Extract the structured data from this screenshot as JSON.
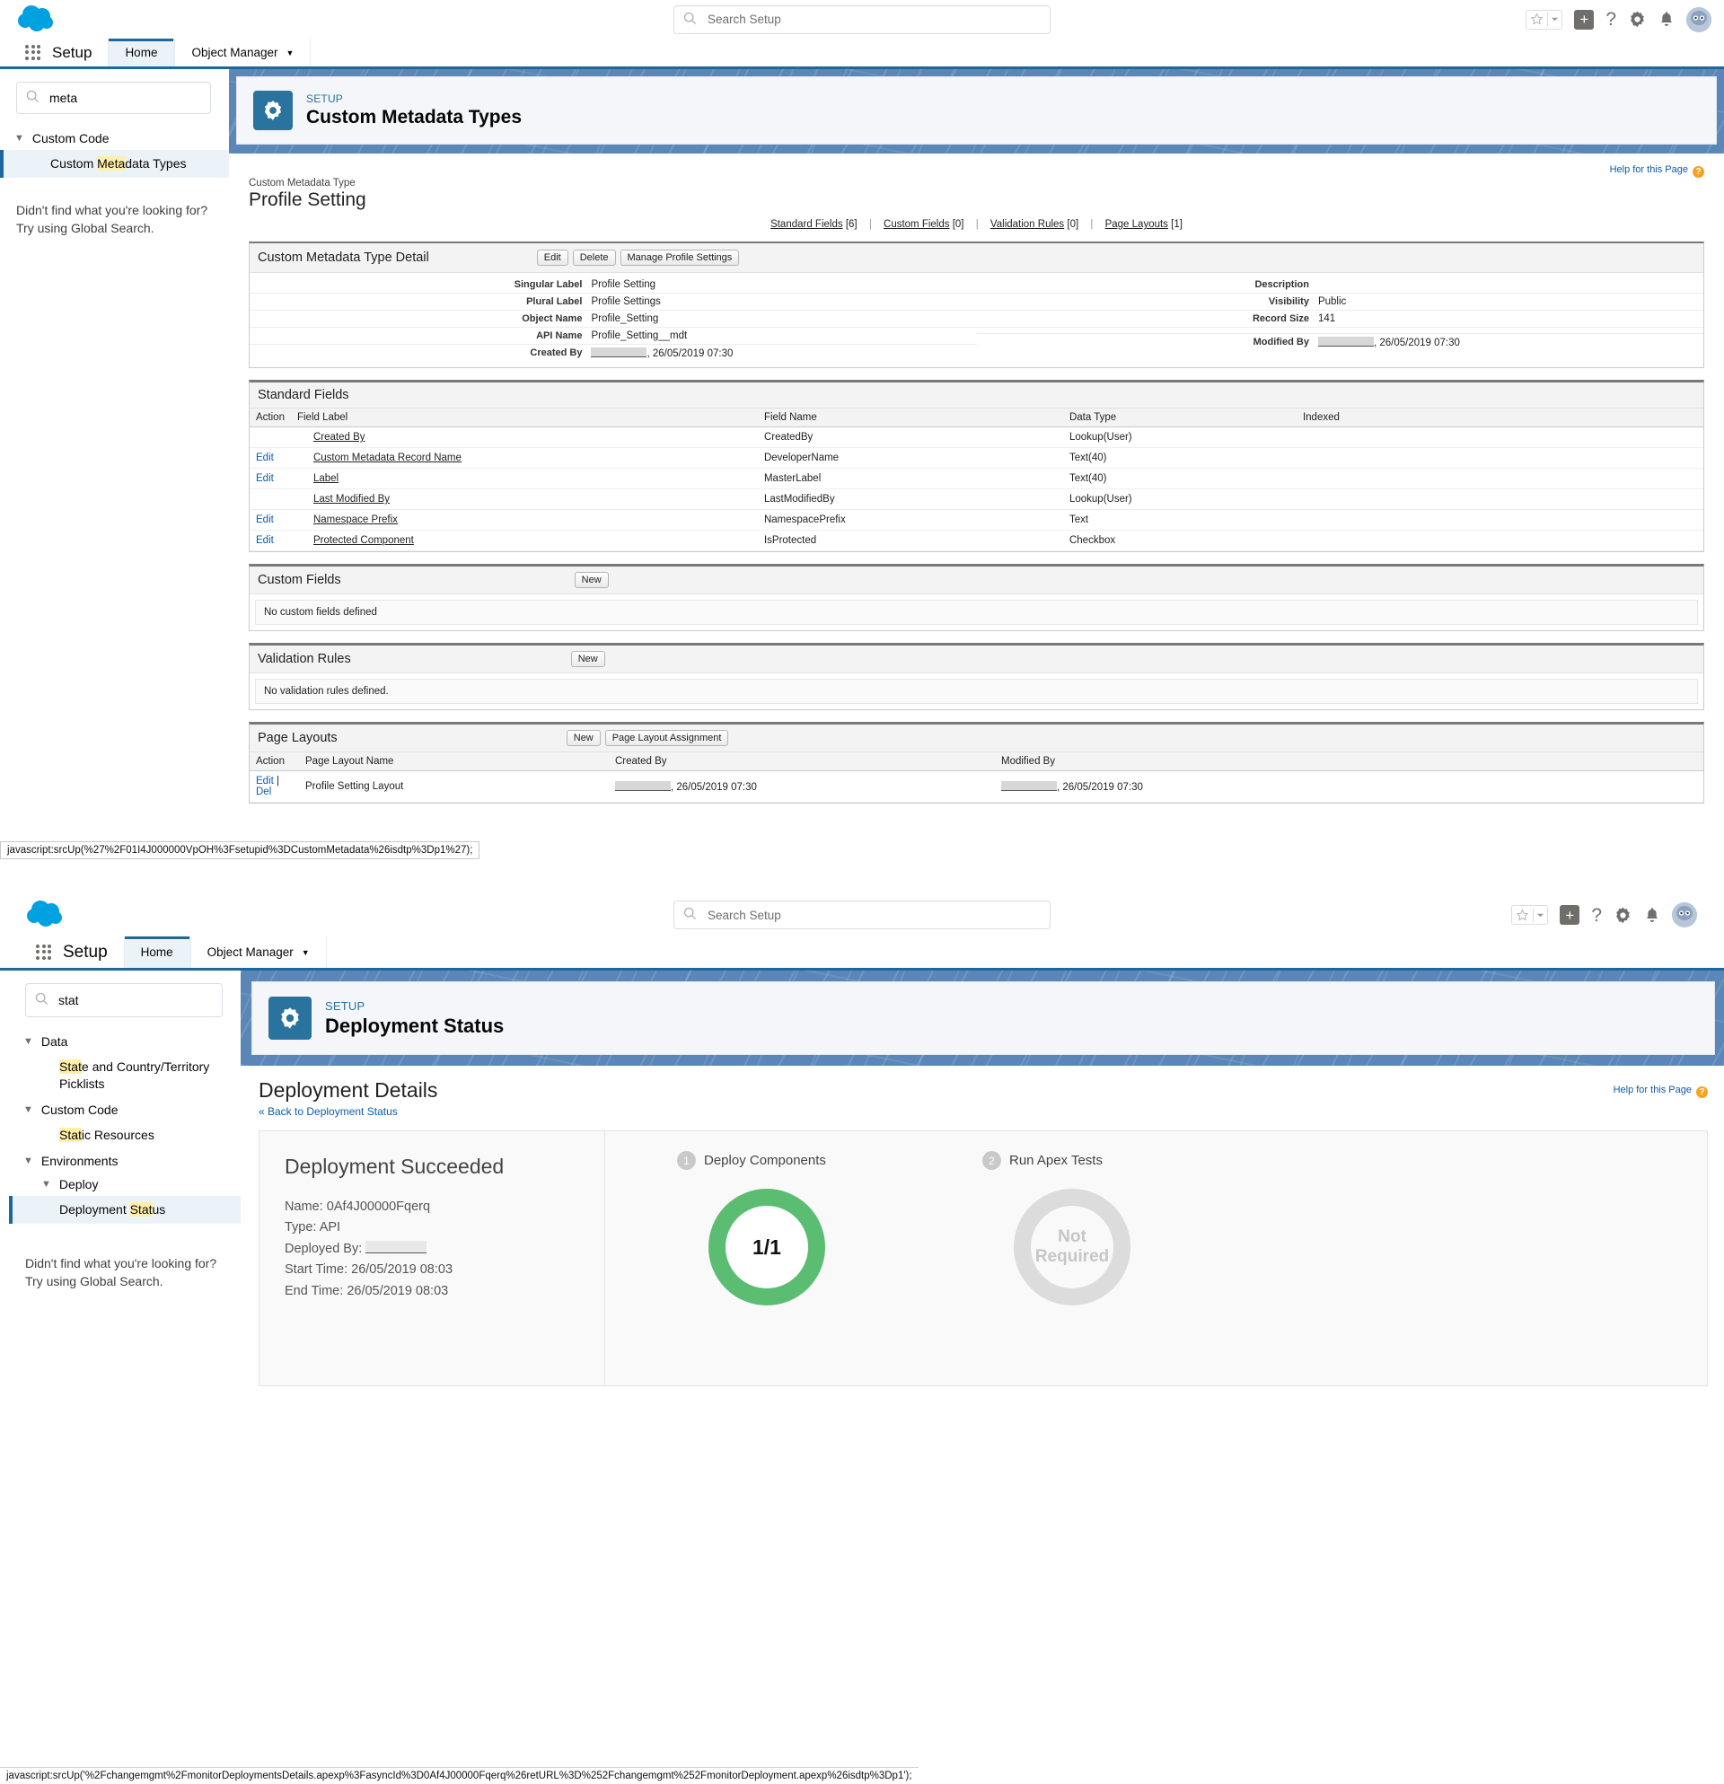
{
  "colors": {
    "brand_blue": "#1c689c",
    "cloud_blue": "#00a1e0",
    "success_green": "#5bbd72",
    "header_bg_blue": "#5a87b8",
    "highlight_yellow": "#ffefa8"
  },
  "panel1": {
    "global_header": {
      "search_placeholder": "Search Setup",
      "icons": [
        "favorites-star-icon",
        "favorites-dropdown-icon",
        "add-icon",
        "help-icon",
        "setup-gear-icon",
        "notifications-bell-icon",
        "user-avatar"
      ]
    },
    "nav": {
      "app_name": "Setup",
      "tabs": [
        {
          "label": "Home",
          "active": true
        },
        {
          "label": "Object Manager",
          "active": false,
          "has_chevron": true
        }
      ]
    },
    "sidebar": {
      "search_value": "meta",
      "search_placeholder": "Quick Find",
      "tree": [
        {
          "type": "group",
          "label": "Custom Code",
          "expanded": true
        },
        {
          "type": "item",
          "label_pre": "Custom ",
          "label_hl": "Meta",
          "label_post": "data Types",
          "selected": true
        }
      ],
      "hint_line1": "Didn't find what you're looking for?",
      "hint_line2": "Try using Global Search."
    },
    "setup_card": {
      "eyebrow": "SETUP",
      "title": "Custom Metadata Types"
    },
    "page": {
      "help_label": "Help for this Page",
      "eyebrow": "Custom Metadata Type",
      "title": "Profile Setting",
      "quick_links": [
        {
          "label": "Standard Fields",
          "count": "[6]"
        },
        {
          "label": "Custom Fields",
          "count": "[0]"
        },
        {
          "label": "Validation Rules",
          "count": "[0]"
        },
        {
          "label": "Page Layouts",
          "count": "[1]"
        }
      ]
    },
    "detail": {
      "title": "Custom Metadata Type Detail",
      "buttons": [
        "Edit",
        "Delete",
        "Manage Profile Settings"
      ],
      "left_fields": [
        {
          "label": "Singular Label",
          "value": "Profile Setting"
        },
        {
          "label": "Plural Label",
          "value": "Profile Settings"
        },
        {
          "label": "Object Name",
          "value": "Profile_Setting"
        },
        {
          "label": "API Name",
          "value": "Profile_Setting__mdt"
        },
        {
          "label": "Created By",
          "value": "26/05/2019 07:30",
          "redacted": true
        }
      ],
      "right_fields": [
        {
          "label": "Description",
          "value": ""
        },
        {
          "label": "Visibility",
          "value": "Public"
        },
        {
          "label": "Record Size",
          "value": "141"
        },
        {
          "label": "",
          "value": ""
        },
        {
          "label": "Modified By",
          "value": "26/05/2019 07:30",
          "redacted": true
        }
      ]
    },
    "standard_fields": {
      "title": "Standard Fields",
      "columns": [
        "Action",
        "Field Label",
        "Field Name",
        "Data Type",
        "Indexed"
      ],
      "rows": [
        {
          "action": "",
          "field_label": "Created By",
          "field_name": "CreatedBy",
          "data_type": "Lookup(User)",
          "indexed": ""
        },
        {
          "action": "Edit",
          "field_label": "Custom Metadata Record Name",
          "field_name": "DeveloperName",
          "data_type": "Text(40)",
          "indexed": ""
        },
        {
          "action": "Edit",
          "field_label": "Label",
          "field_name": "MasterLabel",
          "data_type": "Text(40)",
          "indexed": ""
        },
        {
          "action": "",
          "field_label": "Last Modified By",
          "field_name": "LastModifiedBy",
          "data_type": "Lookup(User)",
          "indexed": ""
        },
        {
          "action": "Edit",
          "field_label": "Namespace Prefix",
          "field_name": "NamespacePrefix",
          "data_type": "Text",
          "indexed": ""
        },
        {
          "action": "Edit",
          "field_label": "Protected Component",
          "field_name": "IsProtected",
          "data_type": "Checkbox",
          "indexed": ""
        }
      ]
    },
    "custom_fields": {
      "title": "Custom Fields",
      "new_button": "New",
      "empty_text": "No custom fields defined"
    },
    "validation_rules": {
      "title": "Validation Rules",
      "new_button": "New",
      "empty_text": "No validation rules defined."
    },
    "page_layouts": {
      "title": "Page Layouts",
      "buttons": [
        "New",
        "Page Layout Assignment"
      ],
      "columns": [
        "Action",
        "Page Layout Name",
        "Created By",
        "Modified By"
      ],
      "rows": [
        {
          "action_edit": "Edit",
          "action_sep": "|",
          "action_del": "Del",
          "name": "Profile Setting Layout",
          "created_by": "26/05/2019 07:30",
          "modified_by": "26/05/2019 07:30"
        }
      ]
    },
    "statusbar": "javascript:srcUp(%27%2F01I4J000000VpOH%3Fsetupid%3DCustomMetadata%26isdtp%3Dp1%27);"
  },
  "panel2": {
    "global_header": {
      "search_placeholder": "Search Setup"
    },
    "nav": {
      "app_name": "Setup",
      "tabs": [
        {
          "label": "Home",
          "active": true
        },
        {
          "label": "Object Manager",
          "active": false,
          "has_chevron": true
        }
      ]
    },
    "sidebar": {
      "search_value": "stat",
      "tree": [
        {
          "type": "group",
          "label": "Data",
          "expanded": true
        },
        {
          "type": "item",
          "label_pre": "",
          "label_hl": "Stat",
          "label_post": "e and Country/Territory Picklists",
          "selected": false
        },
        {
          "type": "group",
          "label": "Custom Code",
          "expanded": true
        },
        {
          "type": "item",
          "label_pre": "",
          "label_hl": "Stat",
          "label_post": "ic Resources",
          "selected": false
        },
        {
          "type": "group",
          "label": "Environments",
          "expanded": true
        },
        {
          "type": "subgroup",
          "label": "Deploy",
          "expanded": true
        },
        {
          "type": "item3",
          "label_pre": "Deployment ",
          "label_hl": "Stat",
          "label_post": "us",
          "selected": true
        }
      ],
      "hint_line1": "Didn't find what you're looking for?",
      "hint_line2": "Try using Global Search."
    },
    "setup_card": {
      "eyebrow": "SETUP",
      "title": "Deployment Status"
    },
    "page": {
      "title": "Deployment Details",
      "back_link": "« Back to Deployment Status",
      "help_label": "Help for this Page"
    },
    "deployment": {
      "status_heading": "Deployment Succeeded",
      "meta": [
        {
          "label": "Name:",
          "value": "0Af4J00000Fqerq"
        },
        {
          "label": "Type:",
          "value": "API"
        },
        {
          "label": "Deployed By:",
          "value": "",
          "redacted": true
        },
        {
          "label": "Start Time:",
          "value": "26/05/2019 08:03"
        },
        {
          "label": "End Time:",
          "value": "26/05/2019 08:03"
        }
      ],
      "steps": [
        {
          "number": "1",
          "label": "Deploy Components",
          "donut_text": "1/1",
          "state": "complete"
        },
        {
          "number": "2",
          "label": "Run Apex Tests",
          "donut_text": "Not Required",
          "state": "not-required"
        }
      ]
    },
    "statusbar": "javascript:srcUp('%2Fchangemgmt%2FmonitorDeploymentsDetails.apexp%3FasyncId%3D0Af4J00000Fqerq%26retURL%3D%252Fchangemgmt%252FmonitorDeployment.apexp%26isdtp%3Dp1');"
  }
}
